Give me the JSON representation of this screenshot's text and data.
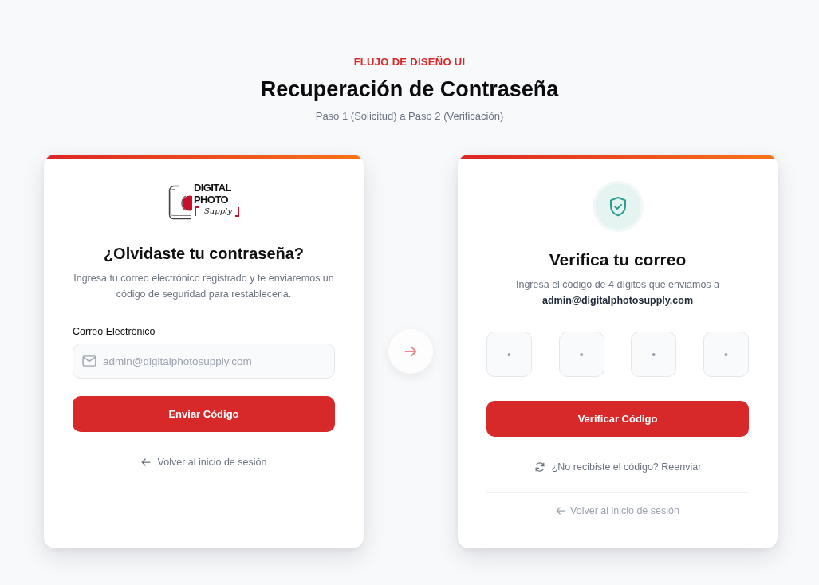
{
  "header": {
    "eyebrow": "FLUJO DE DISEÑO UI",
    "title": "Recuperación de Contraseña",
    "subtitle": "Paso 1 (Solicitud) a Paso 2 (Verificación)"
  },
  "steps": [
    {
      "kind": "request",
      "logo": {
        "line_1": "DIGITAL",
        "line_2": "PHOTO",
        "line_3": "Supply"
      },
      "title": "¿Olvidaste tu contraseña?",
      "description": "Ingresa tu correo electrónico registrado y te enviaremos un código de seguridad para restablecerla.",
      "email_field": {
        "label": "Correo Electrónico",
        "placeholder": "admin@digitalphotosupply.com"
      },
      "submit_button": "Enviar Código",
      "back_link": "Volver al inicio de sesión"
    },
    {
      "kind": "verify",
      "title": "Verifica tu correo",
      "description": "Ingresa el código de 4 dígitos que enviamos a",
      "email": "admin@digitalphotosupply.com",
      "code_digits": [
        {
          "placeholder": "•"
        },
        {
          "placeholder": "•"
        },
        {
          "placeholder": "•"
        },
        {
          "placeholder": "•"
        }
      ],
      "submit_button": "Verificar Código",
      "resend_link": "¿No recibiste el código? Reenviar",
      "back_link": "Volver al inicio de sesión"
    }
  ]
}
